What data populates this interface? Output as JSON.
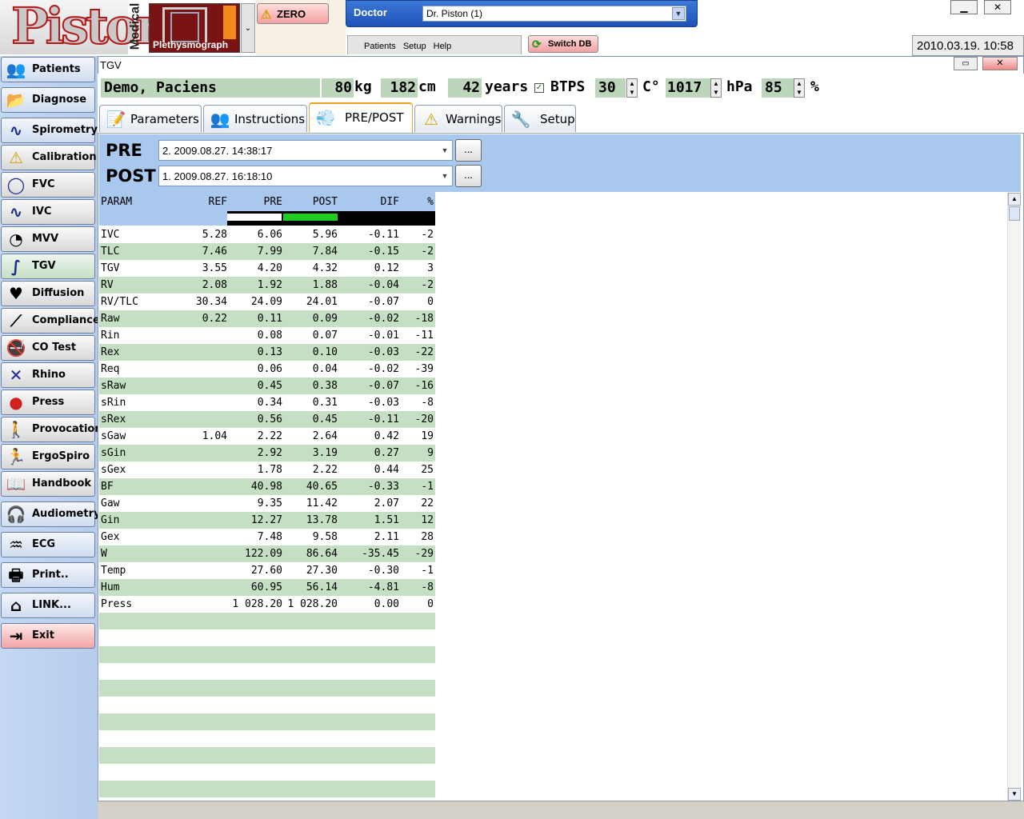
{
  "app": {
    "logo_text": "Piston",
    "medical_label": "Medical",
    "device_label": "Plethysmograph",
    "zero_label": "ZERO",
    "doctor_label": "Doctor",
    "doctor_value": "Dr. Piston (1)",
    "menu": [
      "Patients",
      "Setup",
      "Help"
    ],
    "switch_db_label": "Switch DB",
    "clock": "2010.03.19. 10:58"
  },
  "sidebar": {
    "items": [
      {
        "label": "Patients",
        "icon": "patients-icon",
        "style": "blue"
      },
      {
        "label": "Diagnose",
        "icon": "folder-icon",
        "style": "blue"
      },
      {
        "label": "Spirometry",
        "icon": "wave-icon",
        "style": "blue"
      },
      {
        "label": "Calibration",
        "icon": "warning-icon",
        "style": "gray"
      },
      {
        "label": "FVC",
        "icon": "loop-icon",
        "style": "gray"
      },
      {
        "label": "IVC",
        "icon": "wave-icon",
        "style": "gray"
      },
      {
        "label": "MVV",
        "icon": "gauge-icon",
        "style": "gray"
      },
      {
        "label": "TGV",
        "icon": "curve-icon",
        "style": "active"
      },
      {
        "label": "Diffusion",
        "icon": "heart-wave-icon",
        "style": "gray"
      },
      {
        "label": "Compliance",
        "icon": "ramp-icon",
        "style": "gray"
      },
      {
        "label": "CO Test",
        "icon": "no-smoking-icon",
        "style": "gray"
      },
      {
        "label": "Rhino",
        "icon": "x-icon",
        "style": "gray"
      },
      {
        "label": "Press",
        "icon": "balloon-icon",
        "style": "gray"
      },
      {
        "label": "Provocation",
        "icon": "person-icon",
        "style": "gray"
      },
      {
        "label": "ErgoSpiro",
        "icon": "runner-icon",
        "style": "gray"
      },
      {
        "label": "Handbook",
        "icon": "book-icon",
        "style": "gray"
      },
      {
        "label": "Audiometry",
        "icon": "headphones-icon",
        "style": "blue"
      },
      {
        "label": "ECG",
        "icon": "ecg-icon",
        "style": "blue"
      },
      {
        "label": "Print..",
        "icon": "printer-icon",
        "style": "blue"
      },
      {
        "label": "LINK...",
        "icon": "network-icon",
        "style": "blue"
      },
      {
        "label": "Exit",
        "icon": "exit-icon",
        "style": "red"
      }
    ]
  },
  "window": {
    "title": "TGV"
  },
  "patient": {
    "name": "Demo, Paciens",
    "weight": "80",
    "weight_unit": "kg",
    "height": "182",
    "height_unit": "cm",
    "age": "42",
    "age_unit": "years",
    "btps_label": "BTPS",
    "temp": "30",
    "temp_unit": "C°",
    "pressure": "1017",
    "pressure_unit": "hPa",
    "humidity": "85",
    "humidity_unit": "%"
  },
  "tabs": [
    {
      "label": "Parameters",
      "icon": "chart-pen-icon"
    },
    {
      "label": "Instructions",
      "icon": "people-icon"
    },
    {
      "label": "PRE/POST",
      "icon": "inhaler-icon"
    },
    {
      "label": "Warnings",
      "icon": "warning-icon"
    },
    {
      "label": "Setup",
      "icon": "tools-icon"
    }
  ],
  "prepost": {
    "pre_label": "PRE",
    "post_label": "POST",
    "pre_value": "2. 2009.08.27. 14:38:17",
    "post_value": "1. 2009.08.27. 16:18:10",
    "browse_label": "..."
  },
  "table": {
    "headers": [
      "PARAM",
      "REF",
      "PRE",
      "POST",
      "DIF",
      "%"
    ],
    "rows": [
      [
        "IVC",
        "5.28",
        "6.06",
        "5.96",
        "-0.11",
        "-2"
      ],
      [
        "TLC",
        "7.46",
        "7.99",
        "7.84",
        "-0.15",
        "-2"
      ],
      [
        "TGV",
        "3.55",
        "4.20",
        "4.32",
        "0.12",
        "3"
      ],
      [
        "RV",
        "2.08",
        "1.92",
        "1.88",
        "-0.04",
        "-2"
      ],
      [
        "RV/TLC",
        "30.34",
        "24.09",
        "24.01",
        "-0.07",
        "0"
      ],
      [
        "Raw",
        "0.22",
        "0.11",
        "0.09",
        "-0.02",
        "-18"
      ],
      [
        "Rin",
        "",
        "0.08",
        "0.07",
        "-0.01",
        "-11"
      ],
      [
        "Rex",
        "",
        "0.13",
        "0.10",
        "-0.03",
        "-22"
      ],
      [
        "Req",
        "",
        "0.06",
        "0.04",
        "-0.02",
        "-39"
      ],
      [
        "sRaw",
        "",
        "0.45",
        "0.38",
        "-0.07",
        "-16"
      ],
      [
        "sRin",
        "",
        "0.34",
        "0.31",
        "-0.03",
        "-8"
      ],
      [
        "sRex",
        "",
        "0.56",
        "0.45",
        "-0.11",
        "-20"
      ],
      [
        "sGaw",
        "1.04",
        "2.22",
        "2.64",
        "0.42",
        "19"
      ],
      [
        "sGin",
        "",
        "2.92",
        "3.19",
        "0.27",
        "9"
      ],
      [
        "sGex",
        "",
        "1.78",
        "2.22",
        "0.44",
        "25"
      ],
      [
        "BF",
        "",
        "40.98",
        "40.65",
        "-0.33",
        "-1"
      ],
      [
        "Gaw",
        "",
        "9.35",
        "11.42",
        "2.07",
        "22"
      ],
      [
        "Gin",
        "",
        "12.27",
        "13.78",
        "1.51",
        "12"
      ],
      [
        "Gex",
        "",
        "7.48",
        "9.58",
        "2.11",
        "28"
      ],
      [
        "W",
        "",
        "122.09",
        "86.64",
        "-35.45",
        "-29"
      ],
      [
        "Temp",
        "",
        "27.60",
        "27.30",
        "-0.30",
        "-1"
      ],
      [
        "Hum",
        "",
        "60.95",
        "56.14",
        "-4.81",
        "-8"
      ],
      [
        "Press",
        "",
        "1 028.20",
        "1 028.20",
        "0.00",
        "0"
      ],
      [
        "",
        "",
        "",
        "",
        "",
        ""
      ],
      [
        "",
        "",
        "",
        "",
        "",
        ""
      ],
      [
        "",
        "",
        "",
        "",
        "",
        ""
      ],
      [
        "",
        "",
        "",
        "",
        "",
        ""
      ],
      [
        "",
        "",
        "",
        "",
        "",
        ""
      ],
      [
        "",
        "",
        "",
        "",
        "",
        ""
      ],
      [
        "",
        "",
        "",
        "",
        "",
        ""
      ],
      [
        "",
        "",
        "",
        "",
        "",
        ""
      ],
      [
        "",
        "",
        "",
        "",
        "",
        ""
      ],
      [
        "",
        "",
        "",
        "",
        "",
        ""
      ],
      [
        "",
        "",
        "",
        "",
        "",
        ""
      ]
    ]
  },
  "colors": {
    "row_alt": "#c4dfc4",
    "header_bg": "#a9c8ee",
    "pre_legend": "#ffffff",
    "post_legend": "#22cc22"
  }
}
